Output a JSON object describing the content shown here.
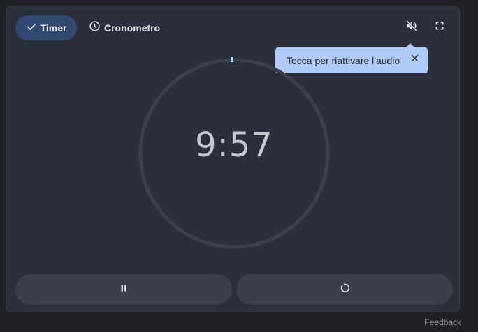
{
  "tabs": {
    "timer_label": "Timer",
    "stopwatch_label": "Cronometro"
  },
  "tooltip": {
    "text": "Tocca per riattivare l'audio"
  },
  "timer": {
    "display": "9:57"
  },
  "footer": {
    "feedback_label": "Feedback"
  },
  "icons": {
    "timer_tab": "check-icon",
    "stopwatch_tab": "clock-icon",
    "mute": "volume-off-icon",
    "fullscreen": "fullscreen-icon",
    "tooltip_close": "close-icon",
    "pause": "pause-icon",
    "reset": "reset-icon"
  },
  "colors": {
    "card_bg": "#2b2f3b",
    "selected_tab": "#324a72",
    "tooltip_bg": "#aecbfa",
    "ring": "#3a3f4e",
    "button_bg": "#3b3f4c"
  }
}
